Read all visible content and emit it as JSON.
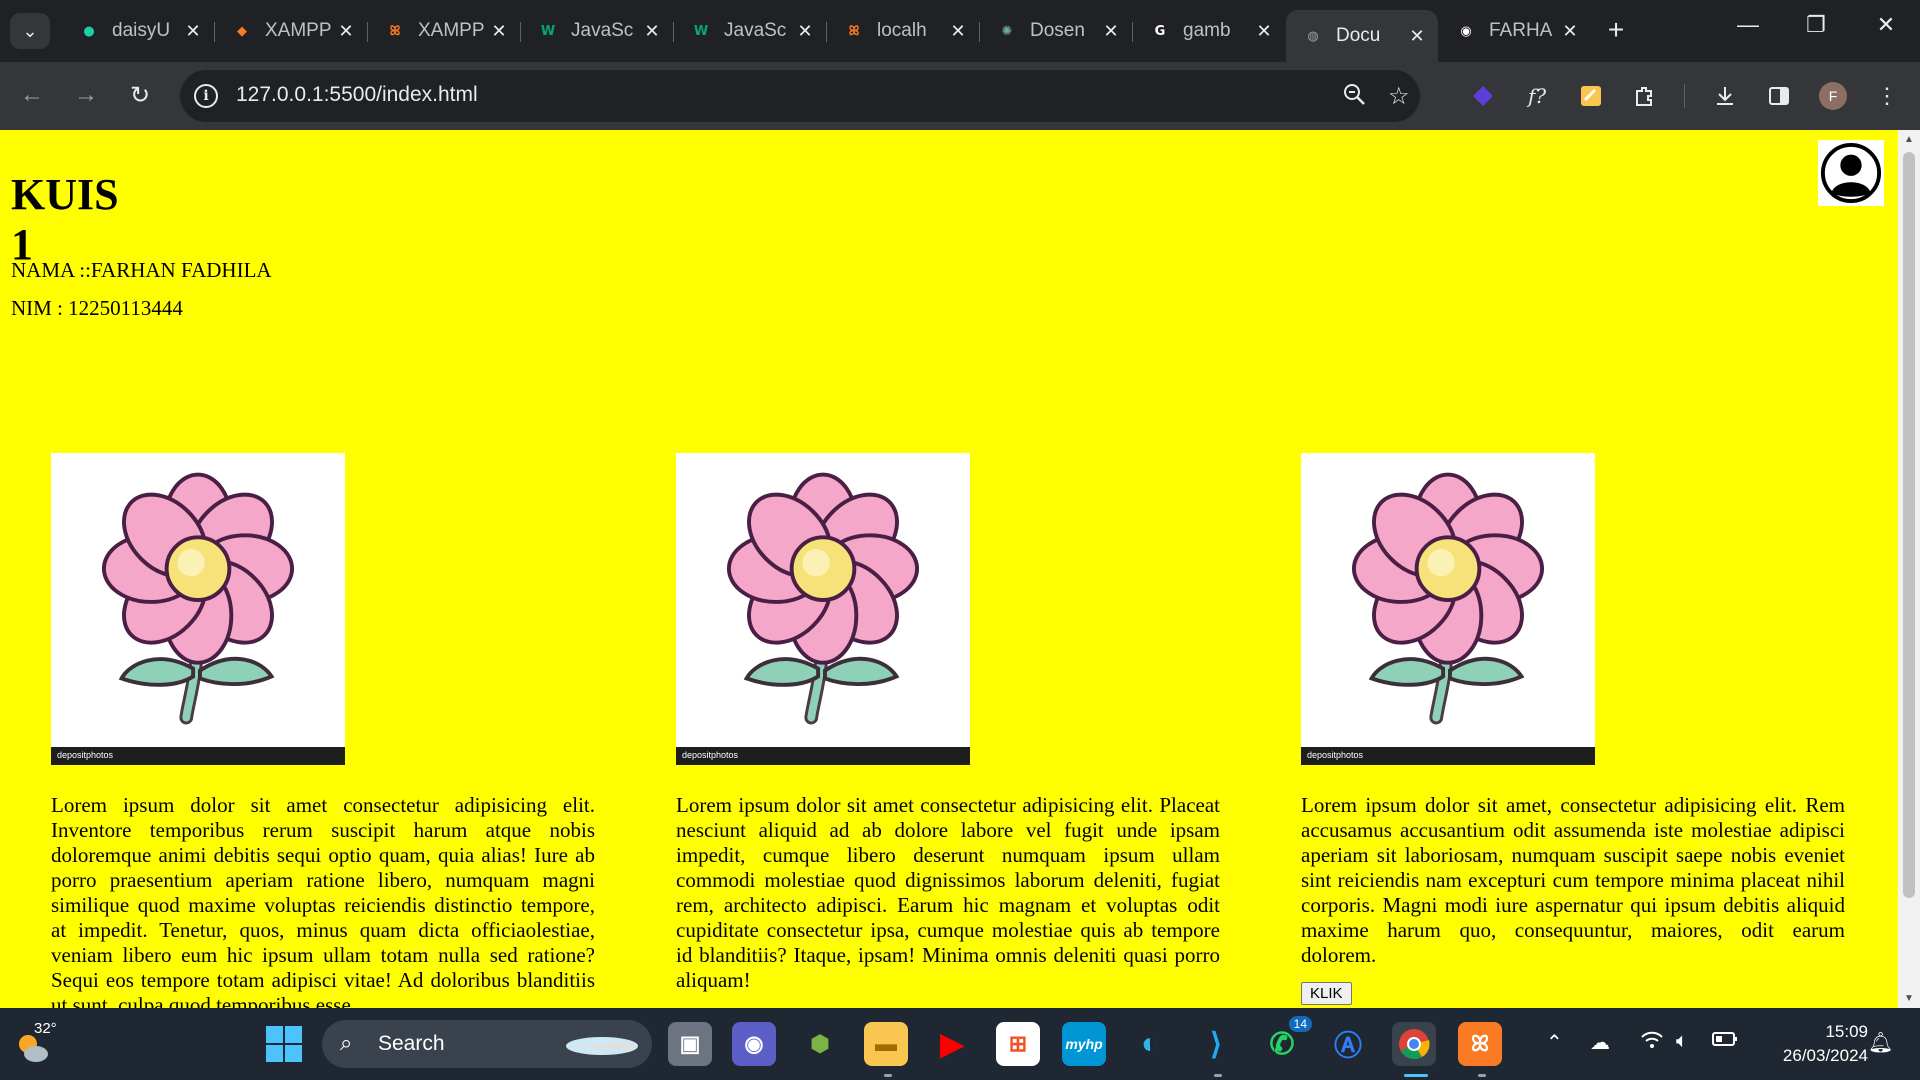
{
  "browser": {
    "tabs": [
      {
        "label": "daisyU",
        "favicon": "daisyui",
        "color": "#1ad1a5",
        "active": false
      },
      {
        "label": "XAMPP",
        "favicon": "xampp-diamond",
        "color": "#fb7a24",
        "active": false
      },
      {
        "label": "XAMPP",
        "favicon": "xampp",
        "color": "#fb7a24",
        "active": false
      },
      {
        "label": "JavaSc",
        "favicon": "w3schools",
        "color": "#04aa6d",
        "active": false
      },
      {
        "label": "JavaSc",
        "favicon": "w3schools",
        "color": "#04aa6d",
        "active": false
      },
      {
        "label": "localh",
        "favicon": "xampp",
        "color": "#fb7a24",
        "active": false
      },
      {
        "label": "Dosen",
        "favicon": "chatgpt",
        "color": "#74aa9c",
        "active": false
      },
      {
        "label": "gamb",
        "favicon": "google",
        "color": "#ffffff",
        "active": false
      },
      {
        "label": "Docu",
        "favicon": "globe",
        "color": "#9aa0a6",
        "active": true
      },
      {
        "label": "FARHA",
        "favicon": "github",
        "color": "#ffffff",
        "active": false
      }
    ],
    "address": "127.0.0.1:5500/index.html",
    "profile_initial": "F"
  },
  "page": {
    "title": "KUIS 1",
    "nama": "NAMA ::FARHAN FADHILA",
    "nim": "NIM : 12250113444",
    "background": "#ffff00",
    "watermark": "depositphotos",
    "cards": [
      {
        "text": "Lorem ipsum dolor sit amet consectetur adipisicing elit. Inventore temporibus rerum suscipit harum atque nobis doloremque animi debitis sequi optio quam, quia alias! Iure ab porro praesentium aperiam ratione libero, numquam magni similique quod maxime voluptas reiciendis distinctio tempore, at impedit. Tenetur, quos, minus quam dicta officiaolestiae, veniam libero eum hic ipsum ullam totam nulla sed ratione? Sequi eos tempore totam adipisci vitae! Ad doloribus blanditiis ut sunt, culpa quod temporibus esse"
      },
      {
        "text": "Lorem ipsum dolor sit amet consectetur adipisicing elit. Placeat nesciunt aliquid ad ab dolore labore vel fugit unde ipsam impedit, cumque libero deserunt numquam ipsum ullam commodi molestiae quod dignissimos laborum deleniti, fugiat rem, architecto adipisci. Earum hic magnam et voluptas odit cupiditate consectetur ipsa, cumque molestiae quis ab tempore id blanditiis? Itaque, ipsam! Minima omnis deleniti quasi porro aliquam!"
      },
      {
        "text": "Lorem ipsum dolor sit amet, consectetur adipisicing elit. Rem accusamus accusantium odit assumenda iste molestiae adipisci aperiam sit laboriosam, numquam suscipit saepe nobis eveniet sint reiciendis nam excepturi cum tempore minima placeat nihil corporis. Magni modi iure aspernatur qui ipsum debitis aliquid maxime harum quo, consequuntur, maiores, odit earum dolorem.",
        "button": "KLIK"
      }
    ]
  },
  "taskbar": {
    "temperature": "32°",
    "search_label": "Search",
    "whatsapp_badge": "14",
    "time": "15:09",
    "date": "26/03/2024"
  }
}
